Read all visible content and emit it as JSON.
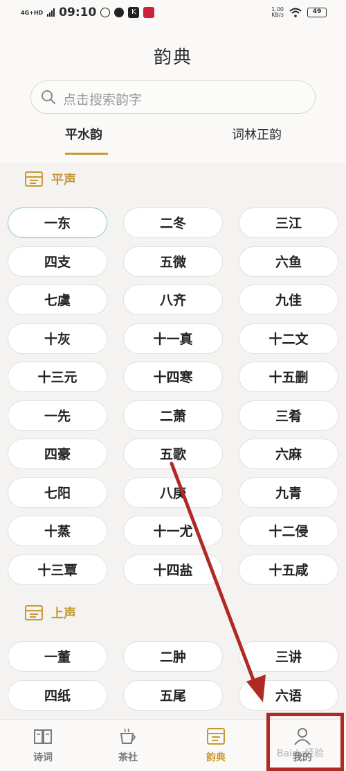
{
  "status_bar": {
    "network": "4G+HD",
    "time": "09:10",
    "speed_value": "1.00",
    "speed_unit": "KB/s",
    "battery": "49"
  },
  "header": {
    "title": "韵典",
    "search_placeholder": "点击搜索韵字",
    "tabs": [
      {
        "label": "平水韵",
        "active": true
      },
      {
        "label": "词林正韵",
        "active": false
      }
    ]
  },
  "sections": [
    {
      "label": "平声",
      "rhymes": [
        "一东",
        "二冬",
        "三江",
        "四支",
        "五微",
        "六鱼",
        "七虞",
        "八齐",
        "九佳",
        "十灰",
        "十一真",
        "十二文",
        "十三元",
        "十四寒",
        "十五删",
        "一先",
        "二萧",
        "三肴",
        "四豪",
        "五歌",
        "六麻",
        "七阳",
        "八庚",
        "九青",
        "十蒸",
        "十一尤",
        "十二侵",
        "十三覃",
        "十四盐",
        "十五咸"
      ]
    },
    {
      "label": "上声",
      "rhymes": [
        "一董",
        "二肿",
        "三讲",
        "四纸",
        "五尾",
        "六语"
      ]
    }
  ],
  "selected_rhyme": "一东",
  "bottom_nav": [
    {
      "label": "诗词",
      "icon": "book-icon",
      "active": false
    },
    {
      "label": "茶社",
      "icon": "teacup-icon",
      "active": false
    },
    {
      "label": "韵典",
      "icon": "rhyme-dictionary-icon",
      "active": true
    },
    {
      "label": "我的",
      "icon": "profile-icon",
      "active": false
    }
  ],
  "watermark": "Baidu经验",
  "colors": {
    "accent": "#c59a35",
    "annotation": "#b02a25",
    "selected_border": "#8fc3d6"
  }
}
